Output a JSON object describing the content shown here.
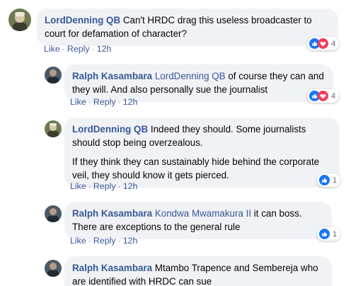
{
  "comments": [
    {
      "author": "LordDenning QB",
      "paragraphs": [
        {
          "mention": "",
          "text": "Can't HRDC drag this useless broadcaster to court for defamation of character?"
        }
      ],
      "like_label": "Like",
      "reply_label": "Reply",
      "time": "12h",
      "reactions": {
        "types": [
          "like",
          "love"
        ],
        "count": "4"
      }
    },
    {
      "author": "Ralph Kasambara",
      "paragraphs": [
        {
          "mention": "LordDenning QB",
          "text": "of course they can and they will. And also personally sue the journalist"
        }
      ],
      "like_label": "Like",
      "reply_label": "Reply",
      "time": "12h",
      "reactions": {
        "types": [
          "like",
          "love"
        ],
        "count": "4"
      }
    },
    {
      "author": "LordDenning QB",
      "paragraphs": [
        {
          "mention": "",
          "text": "Indeed they should. Some journalists should stop being overzealous."
        },
        {
          "mention": "",
          "text": "If they think they can sustainably hide behind the corporate veil, they should know it gets pierced."
        }
      ],
      "like_label": "Like",
      "reply_label": "Reply",
      "time": "12h",
      "reactions": {
        "types": [
          "like"
        ],
        "count": "1"
      }
    },
    {
      "author": "Ralph Kasambara",
      "paragraphs": [
        {
          "mention": "Kondwa Mwamakura II",
          "text": "it can boss. There are exceptions to the general rule"
        }
      ],
      "like_label": "Like",
      "reply_label": "Reply",
      "time": "12h",
      "reactions": {
        "types": [
          "like"
        ],
        "count": "1"
      }
    },
    {
      "author": "Ralph Kasambara",
      "paragraphs": [
        {
          "mention": "",
          "text": "Mtambo Trapence and Sembereja who are identified with HRDC can sue"
        }
      ],
      "like_label": "",
      "reply_label": "",
      "time": "",
      "reactions": {
        "types": [],
        "count": ""
      }
    }
  ],
  "colors": {
    "link": "#385898",
    "bubble": "#f0f2f5",
    "like": "#1877f2",
    "love": "#f33e58"
  }
}
